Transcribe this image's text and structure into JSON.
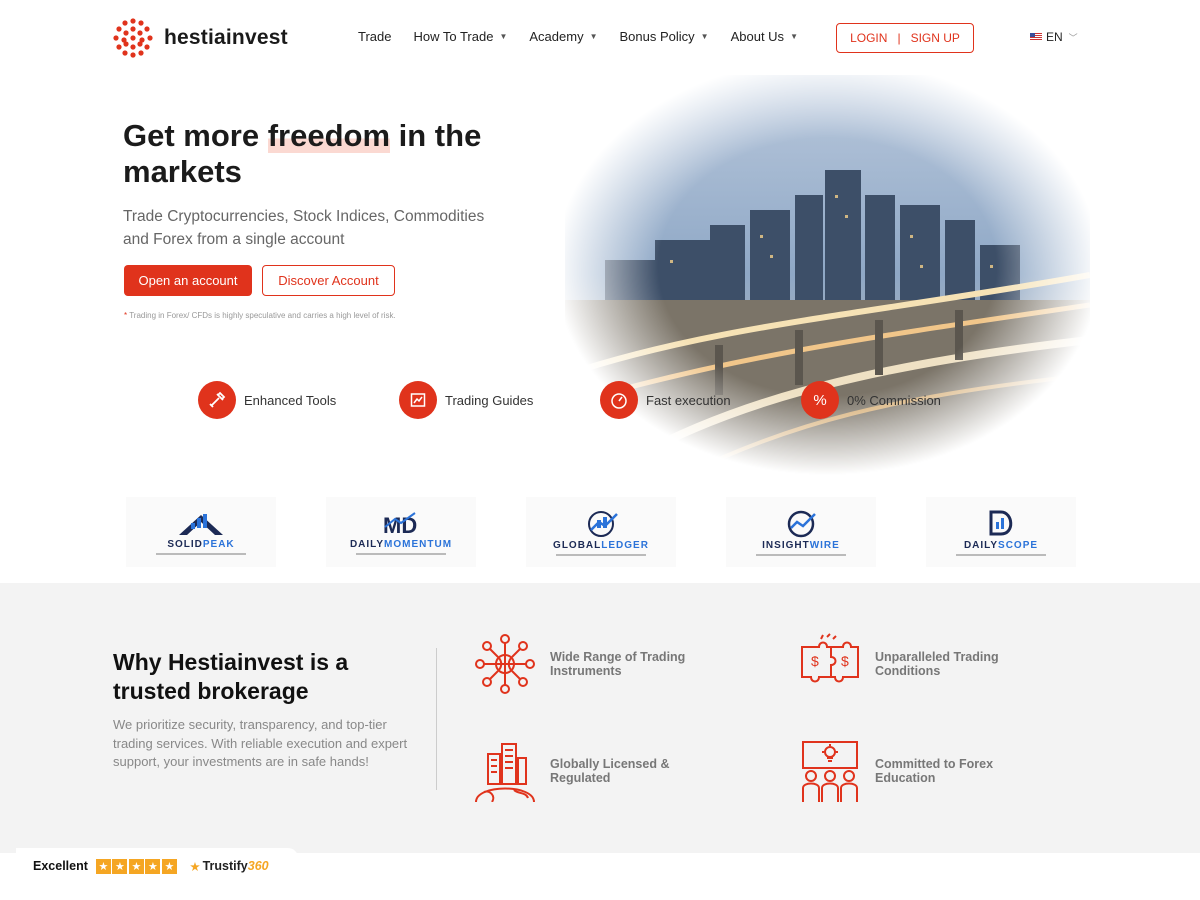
{
  "brand": {
    "name": "hestiainvest",
    "accent": "#e0331c"
  },
  "nav": {
    "items": [
      {
        "label": "Trade",
        "dropdown": false
      },
      {
        "label": "How To Trade",
        "dropdown": true
      },
      {
        "label": "Academy",
        "dropdown": true
      },
      {
        "label": "Bonus Policy",
        "dropdown": true
      },
      {
        "label": "About Us",
        "dropdown": true
      }
    ],
    "login": "LOGIN",
    "signup": "SIGN UP",
    "language": "EN"
  },
  "hero": {
    "title_pre": "Get more ",
    "title_highlight": "freedom",
    "title_post": " in the markets",
    "subtitle": "Trade Cryptocurrencies, Stock Indices, Commodities and Forex from a single account",
    "primary_cta": "Open an account",
    "secondary_cta": "Discover Account",
    "risk_mark": "*",
    "risk_note": " Trading in Forex/ CFDs is highly speculative and carries a high level of risk."
  },
  "features": [
    {
      "label": "Enhanced Tools",
      "icon": "tools-icon"
    },
    {
      "label": "Trading Guides",
      "icon": "guide-icon"
    },
    {
      "label": "Fast execution",
      "icon": "speedometer-icon"
    },
    {
      "label": "0% Commission",
      "icon": "percent-icon"
    }
  ],
  "partners": [
    {
      "pre": "SOLID",
      "post": "PEAK",
      "color": "#1c2a55"
    },
    {
      "pre": "DAILY",
      "post": "MOMENTUM",
      "color": "#1c2a55"
    },
    {
      "pre": "GLOBAL",
      "post": "LEDGER",
      "color": "#1c2a55"
    },
    {
      "pre": "INSIGHT",
      "post": "WIRE",
      "color": "#1c2a55"
    },
    {
      "pre": "DAILY",
      "post": "SCOPE",
      "color": "#1c2a55"
    }
  ],
  "why": {
    "title": "Why Hestiainvest is a trusted brokerage",
    "text": "We prioritize security, transparency, and top-tier trading services. With reliable execution and expert support, your investments are in safe hands!",
    "items": [
      {
        "label": "Wide Range of Trading Instruments",
        "icon": "network-globe-icon"
      },
      {
        "label": "Unparalleled Trading Conditions",
        "icon": "puzzle-money-icon"
      },
      {
        "label": "Globally Licensed & Regulated",
        "icon": "global-buildings-icon"
      },
      {
        "label": "Committed to Forex Education",
        "icon": "education-presentation-icon"
      }
    ]
  },
  "trust": {
    "rating": "Excellent",
    "stars": 5,
    "brand": "Trustify",
    "brand_num": "360"
  }
}
